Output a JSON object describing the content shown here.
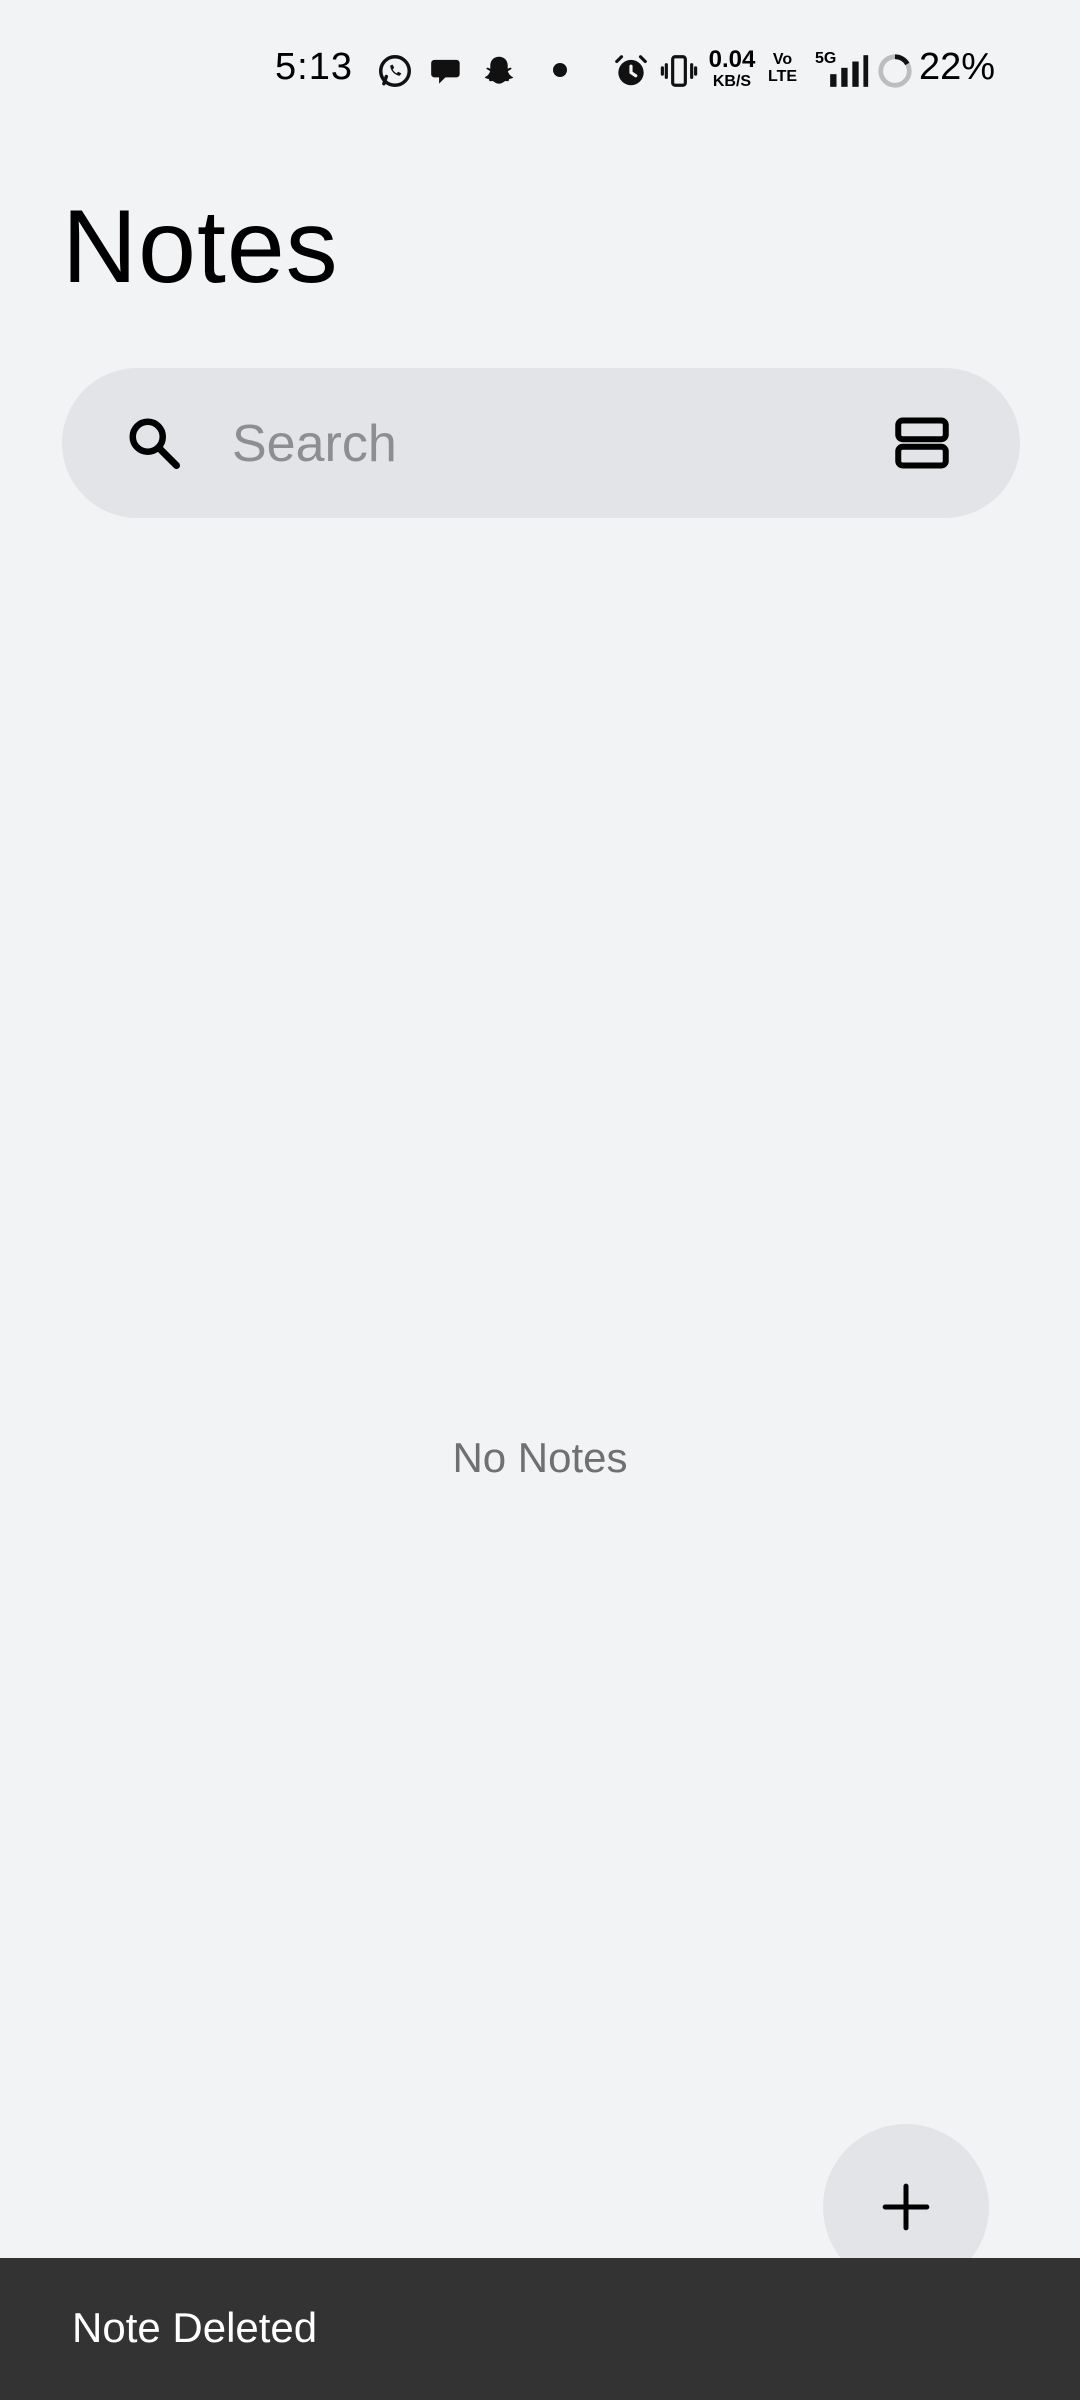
{
  "status_bar": {
    "time": "5:13",
    "net_speed_value": "0.04",
    "net_speed_unit": "KB/S",
    "volte_top": "Vo",
    "volte_bottom": "LTE",
    "network_type": "5G",
    "battery": "22%",
    "icons": [
      "whatsapp-icon",
      "chat-bubble-icon",
      "snapchat-icon",
      "alarm-icon",
      "vibrate-icon",
      "signal-icon",
      "battery-ring-icon"
    ]
  },
  "header": {
    "title": "Notes"
  },
  "search": {
    "placeholder": "Search",
    "value": ""
  },
  "toolbar": {
    "search_icon": "search-icon",
    "layout_toggle_icon": "list-layout-icon"
  },
  "main": {
    "empty_message": "No Notes"
  },
  "fab": {
    "icon": "plus-icon"
  },
  "snackbar": {
    "message": "Note Deleted",
    "background": "#333333"
  },
  "colors": {
    "background": "#f2f3f5",
    "surface": "#e3e4e8",
    "text": "#000000",
    "muted_text": "#707070"
  }
}
